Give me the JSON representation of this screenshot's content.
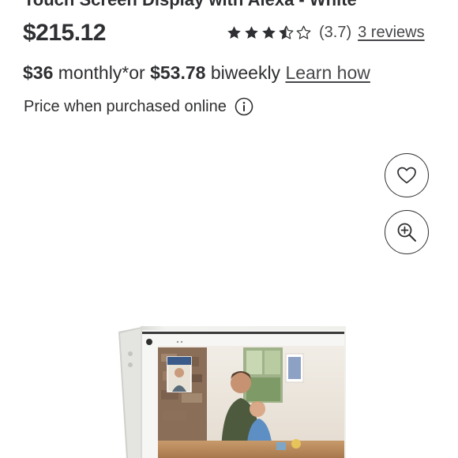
{
  "product": {
    "title_partial": "Touch Screen Display with Alexa - White",
    "price": "$215.12",
    "rating_value": "(3.7)",
    "rating_stars": 3.7,
    "reviews_label": "3 reviews"
  },
  "payment": {
    "monthly_amount": "$36",
    "monthly_text": " monthly*or ",
    "biweekly_amount": "$53.78",
    "biweekly_text": " biweekly ",
    "learn_label": "Learn how"
  },
  "price_note": {
    "text": "Price when purchased online"
  },
  "actions": {
    "favorite_icon": "heart-icon",
    "zoom_icon": "zoom-in-icon"
  },
  "colors": {
    "text": "#2e2f32",
    "star": "#2e2f32"
  }
}
